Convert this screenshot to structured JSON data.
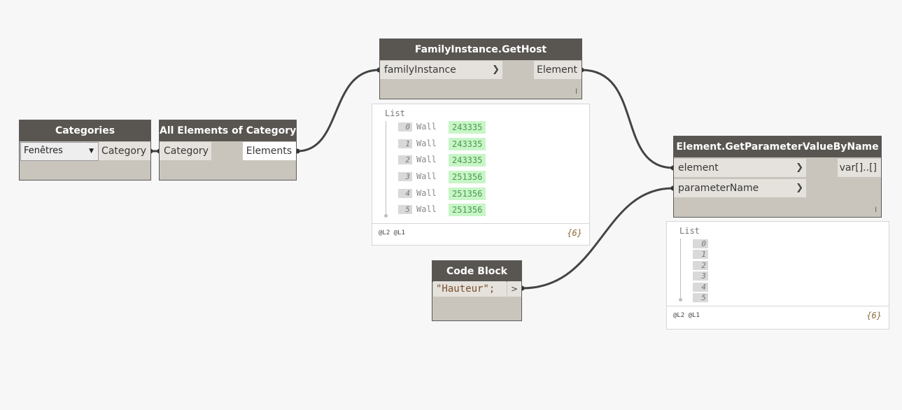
{
  "nodes": {
    "categories": {
      "title": "Categories",
      "dropdown_value": "Fenêtres",
      "output": "Category"
    },
    "all_elements": {
      "title": "All Elements of Category",
      "input": "Category",
      "output": "Elements"
    },
    "get_host": {
      "title": "FamilyInstance.GetHost",
      "input": "familyInstance",
      "output": "Element",
      "lacing": "l"
    },
    "get_param": {
      "title": "Element.GetParameterValueByName",
      "inputs": [
        "element",
        "parameterName"
      ],
      "output": "var[]..[]",
      "lacing": "l"
    },
    "code_block": {
      "title": "Code Block",
      "code": "\"Hauteur\";",
      "output_glyph": ">"
    }
  },
  "previews": {
    "get_host": {
      "title": "List",
      "rows": [
        {
          "index": "0",
          "type": "Wall",
          "value": "243335"
        },
        {
          "index": "1",
          "type": "Wall",
          "value": "243335"
        },
        {
          "index": "2",
          "type": "Wall",
          "value": "243335"
        },
        {
          "index": "3",
          "type": "Wall",
          "value": "251356"
        },
        {
          "index": "4",
          "type": "Wall",
          "value": "251356"
        },
        {
          "index": "5",
          "type": "Wall",
          "value": "251356"
        }
      ],
      "levels": "@L2 @L1",
      "count": "{6}"
    },
    "get_param": {
      "title": "List",
      "rows": [
        "0",
        "1",
        "2",
        "3",
        "4",
        "5"
      ],
      "levels": "@L2 @L1",
      "count": "{6}"
    }
  }
}
